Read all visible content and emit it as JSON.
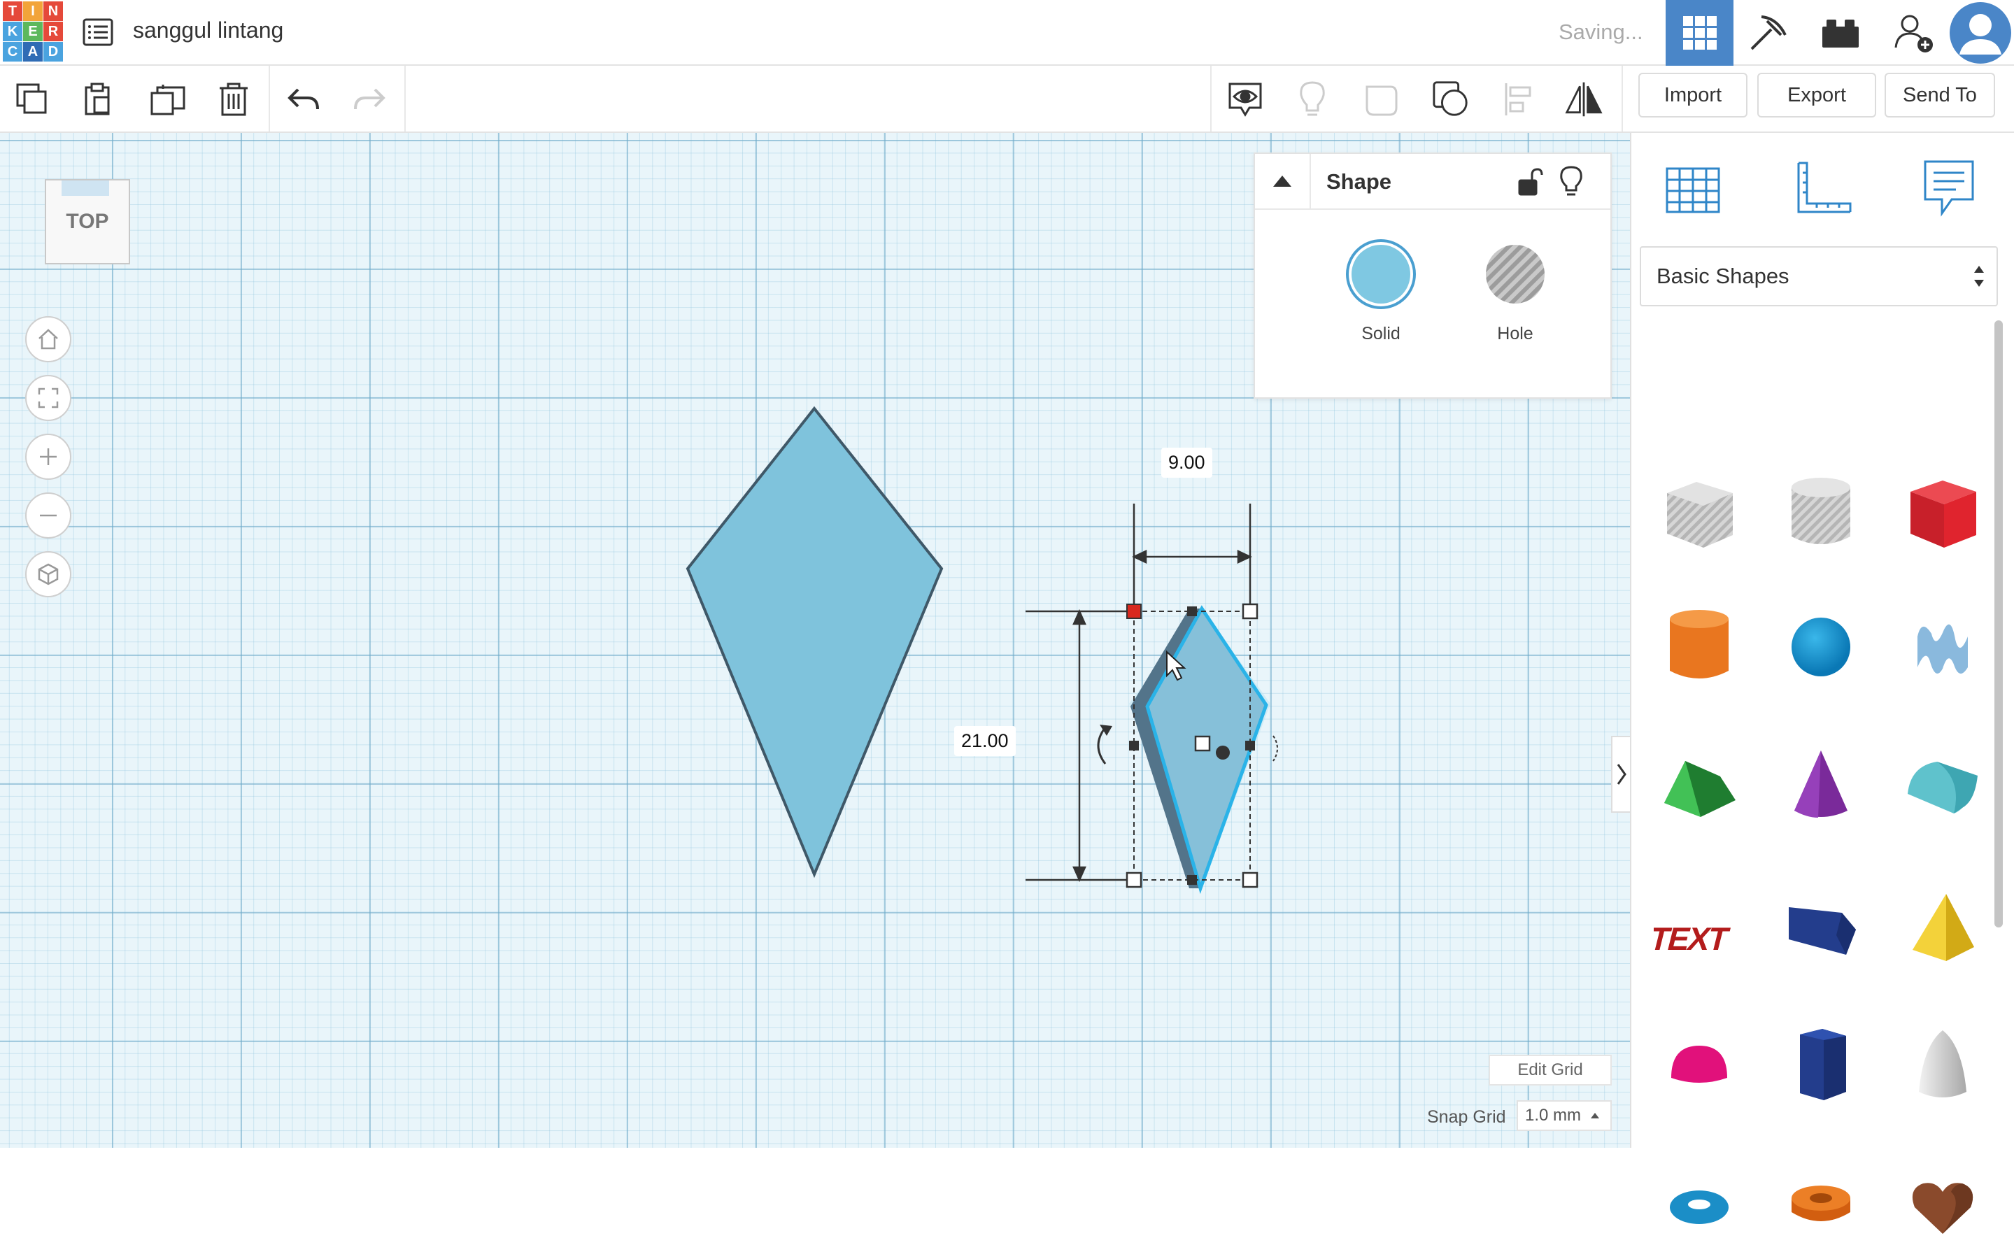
{
  "header": {
    "logo_letters": [
      "T",
      "I",
      "N",
      "K",
      "E",
      "R",
      "C",
      "A",
      "D"
    ],
    "design_title": "sanggul lintang",
    "status": "Saving..."
  },
  "toolbar": {
    "import_label": "Import",
    "export_label": "Export",
    "send_to_label": "Send To"
  },
  "workplane": {
    "view_cube_label": "TOP",
    "dimension_width": "9.00",
    "dimension_height": "21.00",
    "edit_grid_label": "Edit Grid",
    "snap_grid_label": "Snap Grid",
    "snap_grid_value": "1.0 mm"
  },
  "inspector": {
    "title": "Shape",
    "solid_label": "Solid",
    "hole_label": "Hole"
  },
  "library": {
    "category": "Basic Shapes",
    "shapes": [
      "Box",
      "Cylinder",
      "Box",
      "Cylinder",
      "Sphere",
      "Scribble",
      "Roof",
      "Cone",
      "Round Roof",
      "Text",
      "Wedge",
      "Pyramid",
      "Half Sphere",
      "Polygon",
      "Paraboloid",
      "Torus",
      "Tube",
      "Heart"
    ]
  },
  "colors": {
    "accent": "#4a86c8",
    "shape_fill": "#7fc3dc",
    "selection": "#2ab3e8"
  }
}
